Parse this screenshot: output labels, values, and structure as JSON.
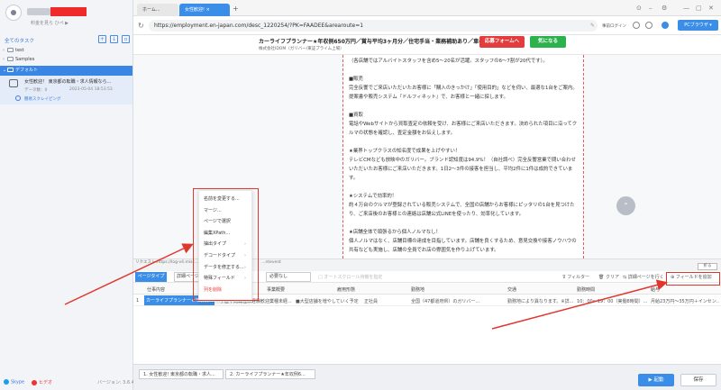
{
  "sidebar": {
    "upgrade_text": "料金を見ら ひペ ▶",
    "all_tasks": "全てのタスク",
    "tree": [
      {
        "label": "test"
      },
      {
        "label": "Samples"
      },
      {
        "label": "デフォルト"
      }
    ],
    "task": {
      "title": "女性歓迎！ 東京都の転職・求人情報なら...",
      "meta": "データ数：0",
      "date": "2023-05-04 18:53:53",
      "link": "簡易スクレイピング"
    },
    "footer": {
      "skype": "Skype",
      "help": "ヒデオ",
      "version": "バージョン: 3.6.4"
    }
  },
  "browser": {
    "tabs": [
      {
        "label": "ホーム..."
      },
      {
        "label": "女性歓迎! ×"
      }
    ],
    "url": "https://employment.en-japan.com/desc_1220254/?PK=FAADEE&arearoute=1",
    "login": "事前ログイン",
    "pc_browser": "PCブラウザ ▾"
  },
  "job": {
    "title": "カーライフプランナー★年収例650万円／賞与平均3ヶ月分／住宅手当・業務補助あり／車の知識は不要",
    "company": "株式会社IDOM（ガリバー/東証プライム上場）",
    "apply": "応募フォームへ",
    "favorite": "気になる"
  },
  "content_lines": [
    "（各店舗ではアルバイトスタッフを含め5～20名が活躍。スタッフの6～7割が20代です）。",
    "",
    "■販売",
    "完全反響でご来店いただいたお客様に「購入のきっかけ」「使用目的」などを伺い、最適な1台をご案内。提案書や販売システム『ドルフィネット』で、お客様と一緒に探します。",
    "",
    "■買取",
    "電話やWebサイトから買取査定の依頼を受け、お客様にご来店いただきます。決められた項目に沿ってクルマの状態を確認し、査定金額をお伝えします。",
    "",
    "★業界トップクラスの知名度で成果を上げやすい！",
    "テレビCMなども放映中のガリバー。ブランド認知度は94.9%！（自社調べ）完全反響営業で問い合わせいただいたお客様にご来店いただきます。1日2～3件の接客を担当し、平均2件に1件は成約できています。",
    "",
    "★システムで効率的！",
    "約４万台のクルマが登録されている販売システムで、全国の店舗からお客様にピッタリの1台を見つけたり、ご来店後のお客様との連絡は店舗公式LINEを使ったり、効率化しています。",
    "",
    "★店舗全体で頑張るから個人ノルマなし！",
    "個人ノルマはなく、店舗目標の達成を目指しています。店舗を良くするため、意見交換や接客ノウハウの共有なども実施し、店舗の全員でお店の雰囲気を作り上げています。",
    "",
    "★ご希望のキャリアが実現！"
  ],
  "status_url": "リクエスト:https://log-v4.misc...",
  "status_event": "...ntevent",
  "collapse": "折る",
  "context_menu": [
    {
      "label": "名前を変更する...",
      "sub": false,
      "danger": false
    },
    {
      "label": "マージ...",
      "sub": false,
      "danger": false
    },
    {
      "label": "ページで選択",
      "sub": false,
      "danger": false
    },
    {
      "label": "編集XPath...",
      "sub": false,
      "danger": false
    },
    {
      "label": "抽出タイプ",
      "sub": true,
      "danger": false
    },
    {
      "label": "デコードタイプ",
      "sub": true,
      "danger": false
    },
    {
      "label": "データを修正する...",
      "sub": true,
      "danger": false
    },
    {
      "label": "特殊フィールド",
      "sub": true,
      "danger": false
    },
    {
      "label": "列を削除",
      "sub": false,
      "danger": true
    }
  ],
  "toolbar": {
    "page_type": "ページタイプ",
    "page_select": "詳細ページ",
    "need_select": "必要なし",
    "loop_check": "□ オートスクロール待機を指定",
    "filter": "フィルター",
    "clear": "クリア",
    "detail": "詳細ページを行く",
    "add_field": "フィールドを追加"
  },
  "table": {
    "headers": [
      "仕事内容",
      "事業概要",
      "雇用形態",
      "勤務地",
      "交通",
      "勤務時間",
      "給与"
    ],
    "row": [
      "1",
      "カーライフプランナー★年収例6...",
      "学歴不問職種未経験歓迎業種未経...",
      "■大型店舗を増やしていく予定...",
      "正社員",
      "全国（47都道府県）のガリバー...",
      "勤務地により異なります。※詳...",
      "10：00～19：00（実働8時間）...",
      "月給23万円～35万円＋インセン..."
    ]
  },
  "bottom": {
    "tabs": [
      "1. 女性歓迎! 東京都の転職・求人...",
      "2. カーライフプランナー★年収例6..."
    ],
    "run": "▶ 起動",
    "save": "保存"
  }
}
